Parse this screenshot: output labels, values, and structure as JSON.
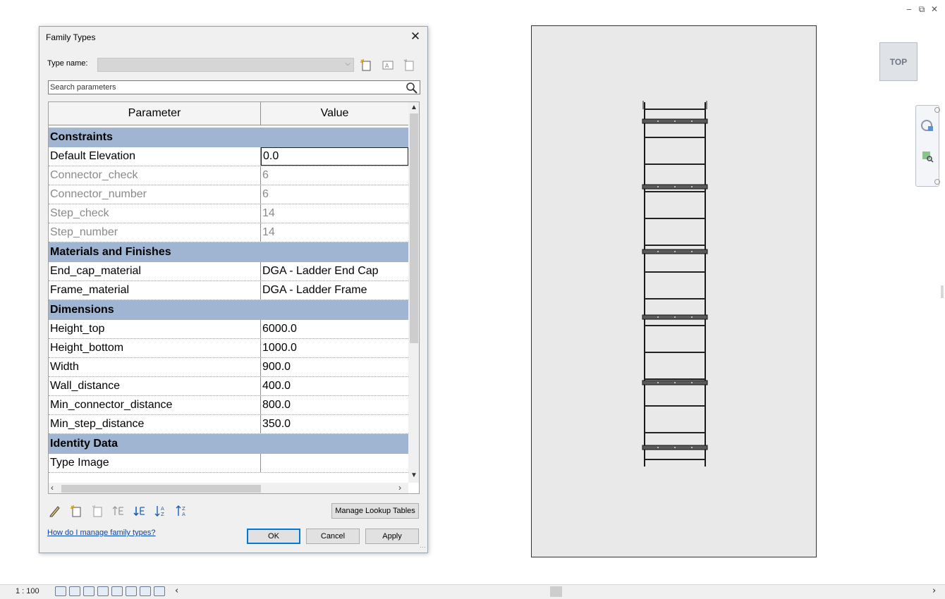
{
  "window_controls": {
    "minimize": "‒",
    "restore": "⧉",
    "close": "✕"
  },
  "dialog": {
    "title": "Family Types",
    "close": "✕",
    "type_name_label": "Type name:",
    "type_name_value": "",
    "search_placeholder": "Search parameters",
    "columns": {
      "parameter": "Parameter",
      "value": "Value"
    },
    "groups": [
      {
        "name": "Constraints",
        "rows": [
          {
            "name": "Default Elevation",
            "value": "0.0",
            "dim": false,
            "editing": true
          },
          {
            "name": "Connector_check",
            "value": "6",
            "dim": true
          },
          {
            "name": "Connector_number",
            "value": "6",
            "dim": true
          },
          {
            "name": "Step_check",
            "value": "14",
            "dim": true
          },
          {
            "name": "Step_number",
            "value": "14",
            "dim": true
          }
        ]
      },
      {
        "name": "Materials and Finishes",
        "rows": [
          {
            "name": "End_cap_material",
            "value": "DGA - Ladder End Cap",
            "dim": false
          },
          {
            "name": "Frame_material",
            "value": "DGA - Ladder Frame",
            "dim": false
          }
        ]
      },
      {
        "name": "Dimensions",
        "rows": [
          {
            "name": "Height_top",
            "value": "6000.0",
            "dim": false
          },
          {
            "name": "Height_bottom",
            "value": "1000.0",
            "dim": false
          },
          {
            "name": "Width",
            "value": "900.0",
            "dim": false
          },
          {
            "name": "Wall_distance",
            "value": "400.0",
            "dim": false
          },
          {
            "name": "Min_connector_distance",
            "value": "800.0",
            "dim": false
          },
          {
            "name": "Min_step_distance",
            "value": "350.0",
            "dim": false
          }
        ]
      },
      {
        "name": "Identity Data",
        "rows": [
          {
            "name": "Type Image",
            "value": "",
            "dim": false
          }
        ]
      }
    ],
    "manage_lookup": "Manage Lookup Tables",
    "help_link": "How do I manage family types?",
    "ok": "OK",
    "cancel": "Cancel",
    "apply": "Apply"
  },
  "viewcube_label": "TOP",
  "status": {
    "scale": "1 : 100"
  }
}
